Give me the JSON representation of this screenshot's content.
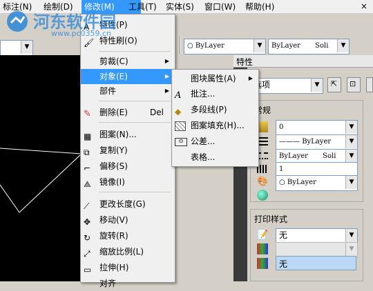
{
  "menubar": {
    "items": [
      {
        "label": "标注(N)"
      },
      {
        "label": "绘制(D)"
      },
      {
        "label": "修改(M)"
      },
      {
        "label": "工具(T)"
      },
      {
        "label": "实体(S)"
      },
      {
        "label": "窗口(W)"
      },
      {
        "label": "帮助(H)"
      }
    ],
    "close_glyph": "×"
  },
  "toolbar": {
    "color_combo": "ByLayer",
    "linetype_combo": "ByLayer",
    "linetype_suffix": "Soli"
  },
  "watermark": {
    "title": "河东软件园",
    "url": "www.pc0359.cn"
  },
  "modify_menu": {
    "items": [
      {
        "label": "特性(P)"
      },
      {
        "label": "特性刷(O)"
      },
      {
        "label": "剪裁(C)"
      },
      {
        "label": "对象(E)"
      },
      {
        "label": "部件"
      },
      {
        "label": "删除(E)",
        "shortcut": "Del"
      },
      {
        "label": "图案(N)..."
      },
      {
        "label": "复制(Y)"
      },
      {
        "label": "偏移(S)"
      },
      {
        "label": "镜像(I)"
      },
      {
        "label": "更改长度(G)"
      },
      {
        "label": "移动(V)"
      },
      {
        "label": "旋转(R)"
      },
      {
        "label": "缩放比例(L)"
      },
      {
        "label": "拉伸(H)"
      },
      {
        "label": "对齐"
      }
    ]
  },
  "object_submenu": {
    "items": [
      {
        "label": "图块属性(A)"
      },
      {
        "label": "批注..."
      },
      {
        "label": "多段线(P)"
      },
      {
        "label": "图案填充(H)..."
      },
      {
        "label": "公差..."
      },
      {
        "label": "表格..."
      }
    ]
  },
  "properties_panel": {
    "header": "特性",
    "selection_combo": "选项",
    "general_section": "常规",
    "color_value": "0",
    "layer_value": "ByLayer",
    "linetype_value": "ByLayer",
    "linetype_suffix": "Soli",
    "scale_value": "1",
    "lineweight_value": "ByLayer",
    "print_section": "打印样式",
    "print_value": "无",
    "print_value2": "无"
  }
}
